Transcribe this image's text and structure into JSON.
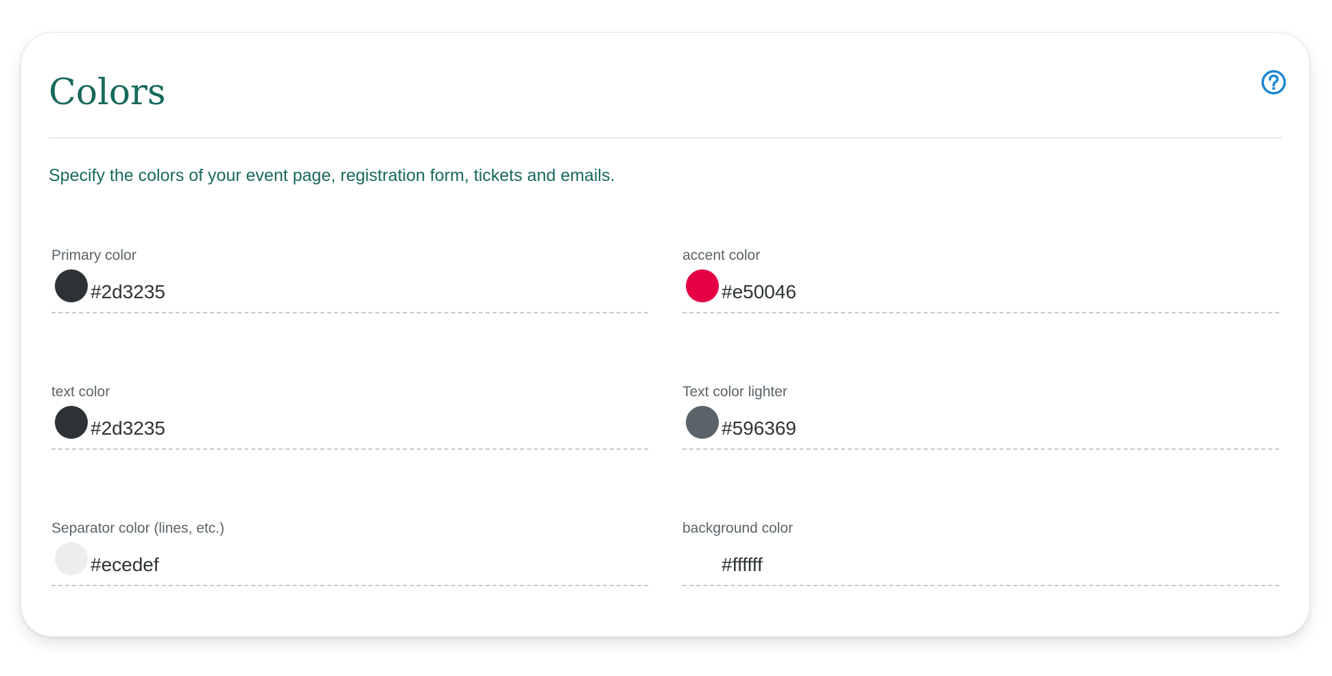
{
  "card": {
    "title": "Colors",
    "description": "Specify the colors of your event page, registration form, tickets and emails.",
    "help_icon": "help-circle-icon"
  },
  "theme": {
    "title_color": "#17695c",
    "help_icon_color": "#1a86d6"
  },
  "fields": {
    "primary": {
      "label": "Primary color",
      "value": "#2d3235"
    },
    "accent": {
      "label": "accent color",
      "value": "#e50046"
    },
    "text": {
      "label": "text color",
      "value": "#2d3235"
    },
    "text_lighter": {
      "label": "Text color lighter",
      "value": "#596369"
    },
    "separator": {
      "label": "Separator color (lines, etc.)",
      "value": "#ecedef"
    },
    "background": {
      "label": "background color",
      "value": "#ffffff"
    }
  }
}
